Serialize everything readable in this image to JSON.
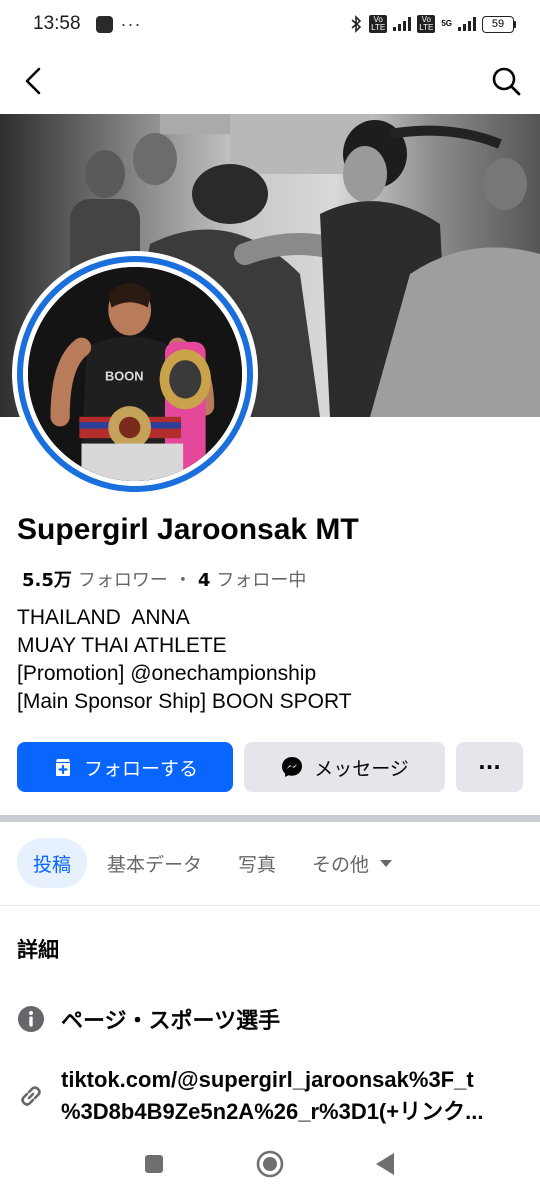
{
  "status_bar": {
    "time": "13:58",
    "more": "···",
    "volte1": "Vo\nLTE",
    "volte2": "Vo\nLTE",
    "network": "5G",
    "battery": "59"
  },
  "nav": {
    "back_icon": "chevron-left-icon",
    "search_icon": "search-icon"
  },
  "profile": {
    "name": "Supergirl Jaroonsak MT",
    "followers_count": "5.5万",
    "followers_label": "フォロワー",
    "separator": "・",
    "following_count": "4",
    "following_label": "フォロー中",
    "bio": [
      "THAILAND  ANNA",
      "MUAY THAI ATHLETE",
      "[Promotion] @onechampionship",
      "[Main Sponsor Ship] BOON SPORT"
    ]
  },
  "actions": {
    "follow_label": "フォローする",
    "message_label": "メッセージ",
    "more_label": "···"
  },
  "tabs": [
    {
      "label": "投稿",
      "active": true
    },
    {
      "label": "基本データ",
      "active": false
    },
    {
      "label": "写真",
      "active": false
    },
    {
      "label": "その他",
      "active": false
    }
  ],
  "details": {
    "title": "詳細",
    "category": "ページ・スポーツ選手",
    "link_line1": "tiktok.com/@supergirl_jaroonsak%3F_t",
    "link_line2": "%3D8b4B9Ze5n2A%26_r%3D1(+リンク..."
  },
  "colors": {
    "primary": "#0866ff",
    "avatar_ring": "#1b6fdd",
    "secondary_button": "#e4e6eb",
    "muted_text": "#65676b"
  }
}
